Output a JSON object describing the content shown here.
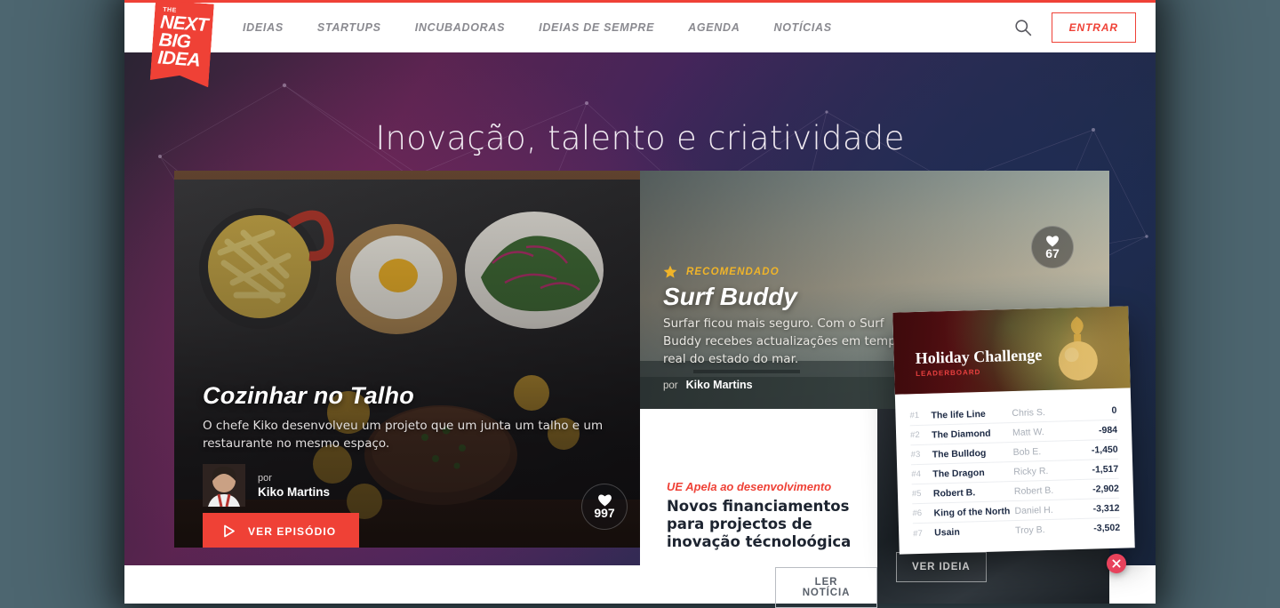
{
  "brand": {
    "logo_the": "THE",
    "logo_lines": [
      "NEXT",
      "BIG",
      "IDEA"
    ],
    "accent": "#ef4136"
  },
  "nav": {
    "items": [
      {
        "label": "IDEIAS"
      },
      {
        "label": "STARTUPS"
      },
      {
        "label": "INCUBADORAS"
      },
      {
        "label": "IDEIAS DE SEMPRE"
      },
      {
        "label": "AGENDA"
      },
      {
        "label": "NOTÍCIAS"
      }
    ],
    "search_icon": "search-icon",
    "login_label": "ENTRAR"
  },
  "hero": {
    "title": "Inovação, talento e criatividade"
  },
  "featured": {
    "title": "Cozinhar no Talho",
    "description": "O chefe Kiko desenvolveu um projeto que um junta um talho e um restaurante no mesmo espaço.",
    "by_label": "por",
    "author": "Kiko Martins",
    "cta_label": "VER EPISÓDIO",
    "cta_icon": "play-icon",
    "likes": "997",
    "like_icon": "heart-icon"
  },
  "surf": {
    "badge_icon": "star-icon",
    "badge_label": "RECOMENDADO",
    "title": "Surf Buddy",
    "description": "Surfar ficou mais seguro. Com o Surf Buddy recebes actualizações em tempo real do estado do mar.",
    "by_label": "por",
    "author": "Kiko Martins",
    "likes": "67",
    "like_icon": "heart-icon"
  },
  "news": {
    "kicker": "UE Apela ao desenvolvimento",
    "title": "Novos financiamentos para projectos de inovação técnoloógica",
    "cta_label": "LER NOTÍCIA"
  },
  "idea": {
    "cta_label": "VER IDEIA"
  },
  "leaderboard": {
    "title": "Holiday Challenge",
    "subtitle": "LEADERBOARD",
    "close_icon": "close-icon",
    "rows": [
      {
        "rank": "#1",
        "team": "The life Line",
        "player": "Chris S.",
        "score": "0"
      },
      {
        "rank": "#2",
        "team": "The Diamond",
        "player": "Matt W.",
        "score": "-984"
      },
      {
        "rank": "#3",
        "team": "The Bulldog",
        "player": "Bob E.",
        "score": "-1,450"
      },
      {
        "rank": "#4",
        "team": "The Dragon",
        "player": "Ricky R.",
        "score": "-1,517"
      },
      {
        "rank": "#5",
        "team": "Robert B.",
        "player": "Robert B.",
        "score": "-2,902"
      },
      {
        "rank": "#6",
        "team": "King of the North",
        "player": "Daniel H.",
        "score": "-3,312"
      },
      {
        "rank": "#7",
        "team": "Usain",
        "player": "Troy B.",
        "score": "-3,502"
      }
    ]
  }
}
